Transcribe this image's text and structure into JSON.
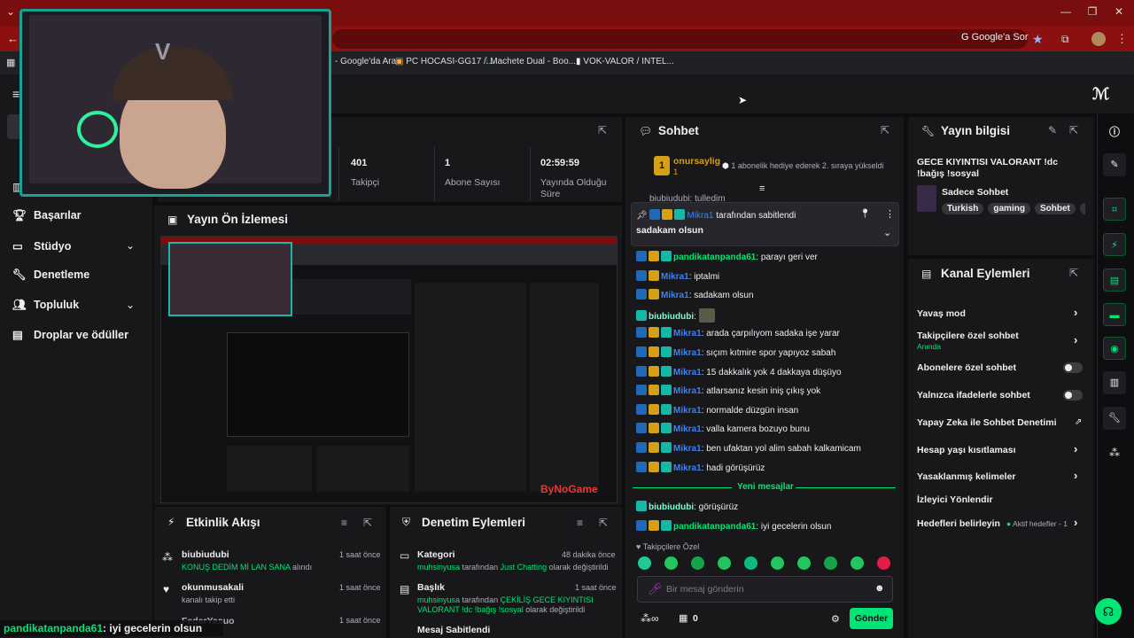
{
  "browser": {
    "google_chip": "Google'a Sor",
    "bookmarks": [
      "- Google'da Ara",
      "PC HOCASI-GG17 /...",
      "Machete Dual - Boo...",
      "VOK-VALOR / INTEL..."
    ]
  },
  "sidebar": {
    "items": [
      {
        "label": "Başarılar",
        "icon": "trophy-icon"
      },
      {
        "label": "Stüdyo",
        "icon": "studio-icon",
        "expandable": true
      },
      {
        "label": "Denetleme",
        "icon": "wrench-icon"
      },
      {
        "label": "Topluluk",
        "icon": "community-icon",
        "expandable": true
      },
      {
        "label": "Droplar ve ödüller",
        "icon": "drops-icon"
      }
    ]
  },
  "stats": [
    {
      "value": "401",
      "label": "Takipçi"
    },
    {
      "value": "1",
      "label": "Abone Sayısı"
    },
    {
      "value": "02:59:59",
      "label": "Yayında Olduğu Süre"
    }
  ],
  "preview": {
    "title": "Yayın Ön İzlemesi"
  },
  "chat": {
    "title": "Sohbet",
    "hype": {
      "rank": "1",
      "user": "onursaylig",
      "count": "1",
      "message": "1 abonelik hediye ederek 2. sıraya yükseldi"
    },
    "truncated_line": "biubiudubi: tulledim",
    "pinned": {
      "by": "Mikra1",
      "by_suffix": "tarafından sabitlendi",
      "text": "sadakam olsun"
    },
    "messages": [
      {
        "user": "pandikatanpanda61",
        "text": "parayı geri ver",
        "color": "green",
        "badges": [
          "blue",
          "gold",
          "teal"
        ]
      },
      {
        "user": "Mikra1",
        "text": "iptalmi",
        "color": "blue",
        "badges": [
          "blue",
          "gold"
        ]
      },
      {
        "user": "Mikra1",
        "text": "sadakam olsun",
        "color": "blue",
        "badges": [
          "blue",
          "gold"
        ]
      },
      {
        "user": "biubiudubi",
        "text": "",
        "color": "mint",
        "badges": [
          "teal"
        ],
        "emote": true
      },
      {
        "user": "Mikra1",
        "text": "arada çarpılıyom sadaka işe yarar",
        "color": "blue",
        "badges": [
          "blue",
          "gold",
          "teal"
        ]
      },
      {
        "user": "Mikra1",
        "text": "sıçım kıtmire spor yapıyoz sabah",
        "color": "blue",
        "badges": [
          "blue",
          "gold",
          "teal"
        ]
      },
      {
        "user": "Mikra1",
        "text": "15 dakkalık yok 4 dakkaya düşüyo",
        "color": "blue",
        "badges": [
          "blue",
          "gold",
          "teal"
        ]
      },
      {
        "user": "Mikra1",
        "text": "atlarsanız kesin iniş çıkış yok",
        "color": "blue",
        "badges": [
          "blue",
          "gold",
          "teal"
        ]
      },
      {
        "user": "Mikra1",
        "text": "normalde düzgün insan",
        "color": "blue",
        "badges": [
          "blue",
          "gold",
          "teal"
        ]
      },
      {
        "user": "Mikra1",
        "text": "valla kamera bozuyo bunu",
        "color": "blue",
        "badges": [
          "blue",
          "gold",
          "teal"
        ]
      },
      {
        "user": "Mikra1",
        "text": "ben ufaktan yol alim sabah kalkamicam",
        "color": "blue",
        "badges": [
          "blue",
          "gold",
          "teal"
        ]
      },
      {
        "user": "Mikra1",
        "text": "hadi görüşürüz",
        "color": "blue",
        "badges": [
          "blue",
          "gold",
          "teal"
        ]
      }
    ],
    "new_messages_label": "Yeni mesajlar",
    "new_messages": [
      {
        "user": "biubiudubi",
        "text": "görüşürüz",
        "color": "mint",
        "badges": [
          "teal"
        ]
      },
      {
        "user": "pandikatanpanda61",
        "text": "iyi gecelerin olsun",
        "color": "green",
        "badges": [
          "blue",
          "gold",
          "teal"
        ]
      }
    ],
    "followers_only_label": "Takipçilere Özel",
    "input_placeholder": "Bir mesaj gönderin",
    "points": "0",
    "send_label": "Gönder"
  },
  "stream_info": {
    "title": "Yayın bilgisi",
    "stream_title": "GECE KIYINTISI VALORANT !dc !bağış !sosyal",
    "category": "Sadece Sohbet",
    "tags": [
      "Turkish",
      "gaming",
      "Sohbet",
      "Mü"
    ]
  },
  "channel_actions": {
    "title": "Kanal Eylemleri",
    "rows": [
      {
        "label": "Yavaş mod",
        "kind": "arrow"
      },
      {
        "label": "Takipçilere özel sohbet",
        "sub": "Anında",
        "kind": "arrow"
      },
      {
        "label": "Abonelere özel sohbet",
        "kind": "toggle"
      },
      {
        "label": "Yalnızca ifadelerle sohbet",
        "kind": "toggle"
      },
      {
        "label": "Yapay Zeka ile Sohbet Denetimi",
        "kind": "external"
      },
      {
        "label": "Hesap yaşı kısıtlaması",
        "kind": "arrow"
      },
      {
        "label": "Yasaklanmış kelimeler",
        "kind": "arrow"
      },
      {
        "label": "İzleyici Yönlendir",
        "kind": "none"
      },
      {
        "label": "Hedefleri belirleyin",
        "status": "Aktif hedefler - 1",
        "kind": "arrow"
      }
    ]
  },
  "activity": {
    "title": "Etkinlik Akışı",
    "items": [
      {
        "user": "biubiudubi",
        "detail": "KONUŞ DEDİM Mİ LAN SANA",
        "detail_suffix": "alındı",
        "time": "1 saat önce"
      },
      {
        "user": "okunmusakali",
        "detail": "kanalı takip etti",
        "detail_suffix": "",
        "time": "1 saat önce"
      },
      {
        "user": "FederYasuo",
        "detail": "",
        "detail_suffix": "",
        "time": "1 saat önce"
      }
    ]
  },
  "moderation": {
    "title": "Denetim Eylemleri",
    "items": [
      {
        "title": "Kategori",
        "actor": "muhsinyusa",
        "mid": "tarafından",
        "value": "Just Chatting",
        "suffix": "olarak değiştirildi",
        "time": "48 dakika önce"
      },
      {
        "title": "Başlık",
        "actor": "muhsinyusa",
        "mid": "tarafından",
        "value": "ÇEKİLİŞ GECE KIYINTISI VALORANT !dc !bağış !sosyal",
        "suffix": "olarak değiştirildi",
        "time": "1 saat önce"
      },
      {
        "title": "Mesaj Sabitlendi",
        "actor": "",
        "mid": "",
        "value": "",
        "suffix": "",
        "time": ""
      }
    ]
  },
  "overlay": {
    "bottom_user": "pandikatanpanda61",
    "bottom_text": ": iyi gecelerin olsun",
    "watermark": "ByNoGame"
  },
  "colors": {
    "accent_green": "#00e676",
    "mod_blue": "#1f69b8",
    "chrome_red": "#8c1010",
    "panel": "#18181b"
  }
}
